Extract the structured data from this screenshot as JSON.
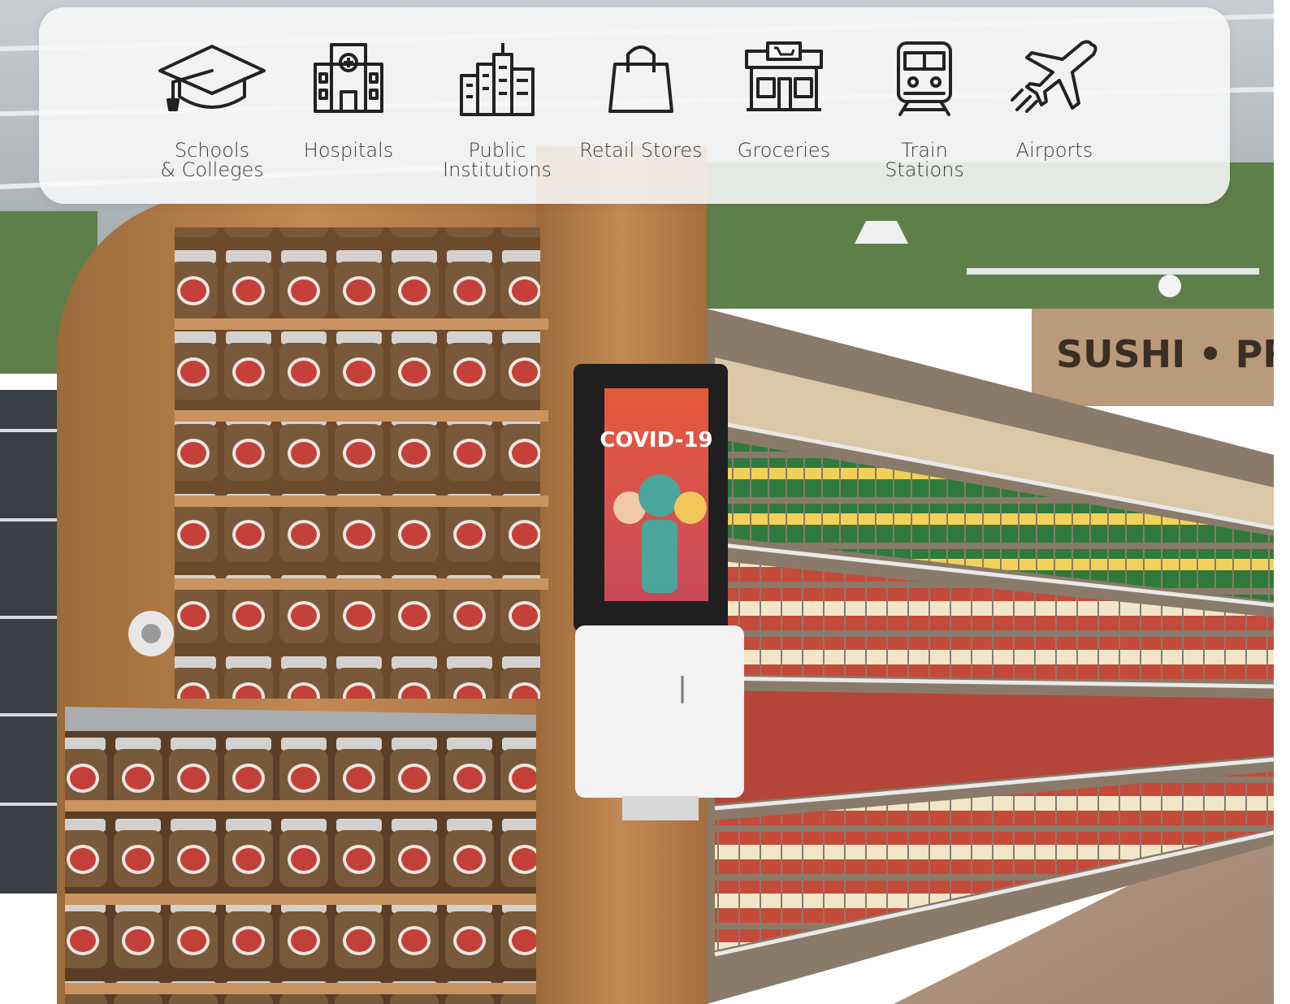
{
  "categories": [
    {
      "label": "Schools\n& Colleges",
      "icon": "graduation-cap-icon"
    },
    {
      "label": "Hospitals",
      "icon": "hospital-icon"
    },
    {
      "label": "Public\nInstitutions",
      "icon": "city-buildings-icon"
    },
    {
      "label": "Retail Stores",
      "icon": "shopping-bag-icon"
    },
    {
      "label": "Groceries",
      "icon": "grocery-store-icon"
    },
    {
      "label": "Train\nStations",
      "icon": "train-icon"
    },
    {
      "label": "Airports",
      "icon": "airplane-icon"
    }
  ],
  "kiosk": {
    "screen_text": "COVID-19"
  },
  "store_sign": {
    "text": "SUSHI • PR"
  },
  "colors": {
    "icon_stroke": "#222222",
    "label_text": "#3a3a3a",
    "wood": "#b07a45",
    "wall_green": "#5f7f4a",
    "kiosk_screen": "#e06b45"
  }
}
